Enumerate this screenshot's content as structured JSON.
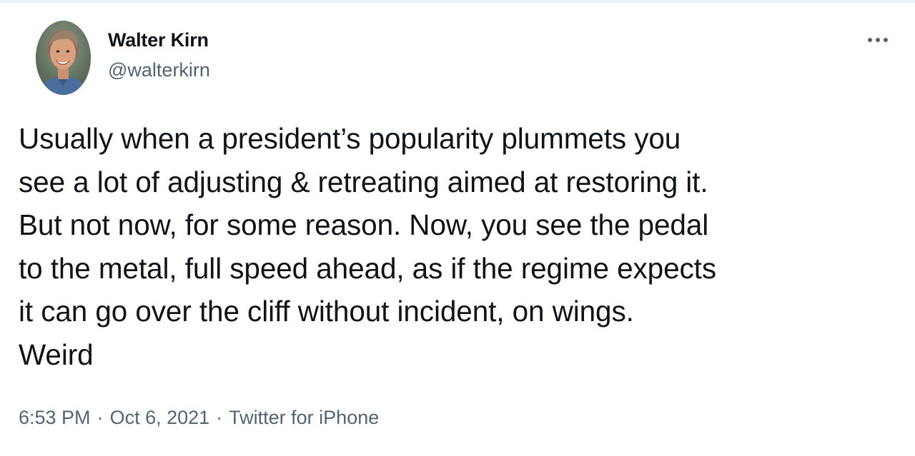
{
  "tweet": {
    "author": {
      "display_name": "Walter Kirn",
      "handle": "@walterkirn"
    },
    "text": "Usually when a president’s popularity plummets you\nsee a lot of adjusting & retreating aimed at restoring it.\nBut not now, for some reason. Now, you see the pedal\nto the metal, full speed ahead, as if the regime expects\nit can go over the cliff without incident, on wings.\nWeird",
    "time": "6:53 PM",
    "date": "Oct 6, 2021",
    "source": "Twitter for iPhone",
    "separator": "·"
  },
  "icons": {
    "more": "more-horizontal-icon"
  },
  "colors": {
    "text_primary": "#0f1419",
    "text_secondary": "#536471",
    "background": "#ffffff"
  }
}
